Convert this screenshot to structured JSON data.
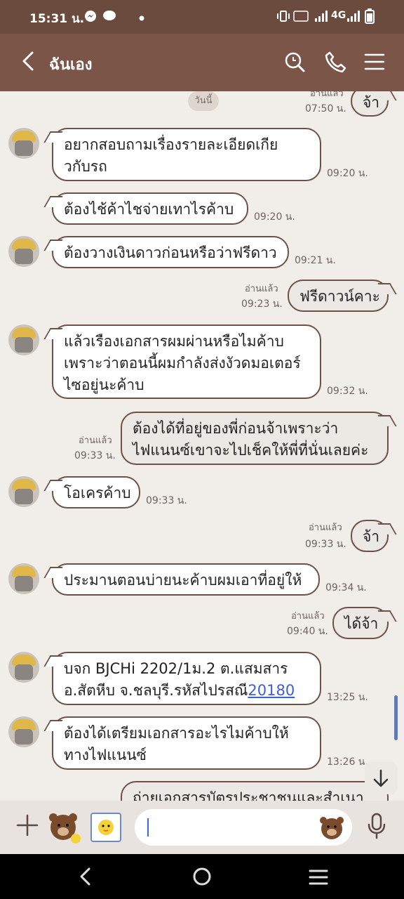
{
  "status_bar": {
    "time": "15:31 น.",
    "network": "4G"
  },
  "header": {
    "title": "ฉันเอง"
  },
  "day_label": "วันนี้",
  "messages": [
    {
      "dir": "out",
      "text": [
        "จ้า"
      ],
      "read": "อ่านแล้ว",
      "time": "07:50 น."
    },
    {
      "dir": "in",
      "text": [
        "อยากสอบถามเรื่องรายละเอียดเกีย",
        "วกับรถ"
      ],
      "time": "09:20 น."
    },
    {
      "dir": "in",
      "text": [
        "ต้องไช้ค้าไชจ่ายเทาไรค้าบ"
      ],
      "time": "09:20 น."
    },
    {
      "dir": "in",
      "text": [
        "ต้องวางเงินดาวก่อนหรือว่าฟรีดาว"
      ],
      "time": "09:21 น."
    },
    {
      "dir": "out",
      "text": [
        "ฟรีดาวน์คาะ"
      ],
      "read": "อ่านแล้ว",
      "time": "09:23 น."
    },
    {
      "dir": "in",
      "text": [
        "แล้วเรืองเอกสารผมผ่านหรือไมค้าบ",
        "เพราะว่าตอนนี้ผมกำลังส่งงัวดมอเตอร์",
        "ไซอยู่นะค้าบ"
      ],
      "time": "09:32 น."
    },
    {
      "dir": "out",
      "text": [
        "ต้องได้ที่อยู่ของพี่ก่อนจ้าเพราะว่า",
        "ไฟแนนซ์เขาจะไปเช็คให้พี่ที่นั่นเลยค่ะ"
      ],
      "read": "อ่านแล้ว",
      "time": "09:33 น."
    },
    {
      "dir": "in",
      "text": [
        "โอเครค้าบ"
      ],
      "time": "09:33 น."
    },
    {
      "dir": "out",
      "text": [
        "จ้า"
      ],
      "read": "อ่านแล้ว",
      "time": "09:33 น."
    },
    {
      "dir": "in",
      "text": [
        "ประมานตอนบ่ายนะค้าบผมเอาที่อยู่ให้"
      ],
      "time": "09:34 น."
    },
    {
      "dir": "out",
      "text": [
        "ได้จ้า"
      ],
      "read": "อ่านแล้ว",
      "time": "09:40 น."
    },
    {
      "dir": "in",
      "text": [
        "บจก BJCHi 2202/1ม.2 ต.แสมสาร",
        "อ.สัตหีบ จ.ชลบุรี.รหัสไปรสณี"
      ],
      "link": "20180",
      "time": "13:25 น."
    },
    {
      "dir": "in",
      "text": [
        "ต้องได้เตรียมเอกสารอะไรไมค้าบให้",
        "ทางไฟแนนซ์"
      ],
      "time": "13:26 น."
    },
    {
      "dir": "out",
      "text": [
        "ถ่ายเอกสารบัตรประชาชนและสำเนา"
      ]
    }
  ],
  "icons": {
    "back": "chevron-left-icon",
    "search": "search-icon",
    "call": "phone-icon",
    "menu": "hamburger-menu-icon",
    "plus": "plus-icon",
    "sticker": "sticker-icon",
    "photo": "photo-icon",
    "emoji": "emoji-icon",
    "mic": "microphone-icon",
    "scroll_down": "arrow-down-icon"
  },
  "colors": {
    "header": "#7b5648",
    "status_bar": "#6b4b3e",
    "chat_bg": "#f1ede8",
    "bubble_border": "#6b5248",
    "link": "#3d5fd1"
  }
}
